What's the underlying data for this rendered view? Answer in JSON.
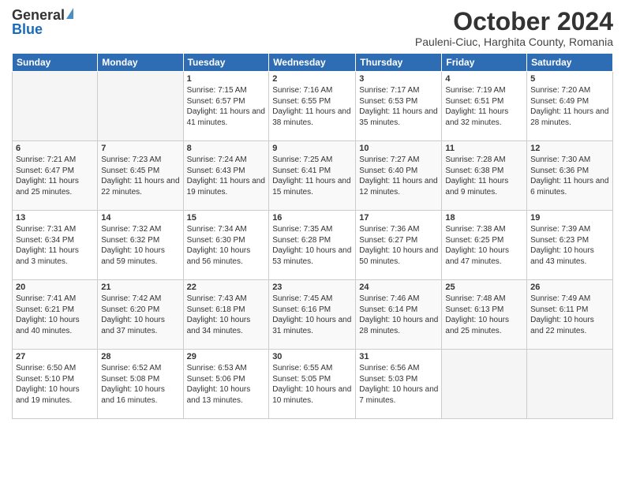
{
  "logo": {
    "general": "General",
    "blue": "Blue"
  },
  "title": "October 2024",
  "subtitle": "Pauleni-Ciuc, Harghita County, Romania",
  "headers": [
    "Sunday",
    "Monday",
    "Tuesday",
    "Wednesday",
    "Thursday",
    "Friday",
    "Saturday"
  ],
  "weeks": [
    [
      {
        "day": "",
        "info": ""
      },
      {
        "day": "",
        "info": ""
      },
      {
        "day": "1",
        "info": "Sunrise: 7:15 AM\nSunset: 6:57 PM\nDaylight: 11 hours and 41 minutes."
      },
      {
        "day": "2",
        "info": "Sunrise: 7:16 AM\nSunset: 6:55 PM\nDaylight: 11 hours and 38 minutes."
      },
      {
        "day": "3",
        "info": "Sunrise: 7:17 AM\nSunset: 6:53 PM\nDaylight: 11 hours and 35 minutes."
      },
      {
        "day": "4",
        "info": "Sunrise: 7:19 AM\nSunset: 6:51 PM\nDaylight: 11 hours and 32 minutes."
      },
      {
        "day": "5",
        "info": "Sunrise: 7:20 AM\nSunset: 6:49 PM\nDaylight: 11 hours and 28 minutes."
      }
    ],
    [
      {
        "day": "6",
        "info": "Sunrise: 7:21 AM\nSunset: 6:47 PM\nDaylight: 11 hours and 25 minutes."
      },
      {
        "day": "7",
        "info": "Sunrise: 7:23 AM\nSunset: 6:45 PM\nDaylight: 11 hours and 22 minutes."
      },
      {
        "day": "8",
        "info": "Sunrise: 7:24 AM\nSunset: 6:43 PM\nDaylight: 11 hours and 19 minutes."
      },
      {
        "day": "9",
        "info": "Sunrise: 7:25 AM\nSunset: 6:41 PM\nDaylight: 11 hours and 15 minutes."
      },
      {
        "day": "10",
        "info": "Sunrise: 7:27 AM\nSunset: 6:40 PM\nDaylight: 11 hours and 12 minutes."
      },
      {
        "day": "11",
        "info": "Sunrise: 7:28 AM\nSunset: 6:38 PM\nDaylight: 11 hours and 9 minutes."
      },
      {
        "day": "12",
        "info": "Sunrise: 7:30 AM\nSunset: 6:36 PM\nDaylight: 11 hours and 6 minutes."
      }
    ],
    [
      {
        "day": "13",
        "info": "Sunrise: 7:31 AM\nSunset: 6:34 PM\nDaylight: 11 hours and 3 minutes."
      },
      {
        "day": "14",
        "info": "Sunrise: 7:32 AM\nSunset: 6:32 PM\nDaylight: 10 hours and 59 minutes."
      },
      {
        "day": "15",
        "info": "Sunrise: 7:34 AM\nSunset: 6:30 PM\nDaylight: 10 hours and 56 minutes."
      },
      {
        "day": "16",
        "info": "Sunrise: 7:35 AM\nSunset: 6:28 PM\nDaylight: 10 hours and 53 minutes."
      },
      {
        "day": "17",
        "info": "Sunrise: 7:36 AM\nSunset: 6:27 PM\nDaylight: 10 hours and 50 minutes."
      },
      {
        "day": "18",
        "info": "Sunrise: 7:38 AM\nSunset: 6:25 PM\nDaylight: 10 hours and 47 minutes."
      },
      {
        "day": "19",
        "info": "Sunrise: 7:39 AM\nSunset: 6:23 PM\nDaylight: 10 hours and 43 minutes."
      }
    ],
    [
      {
        "day": "20",
        "info": "Sunrise: 7:41 AM\nSunset: 6:21 PM\nDaylight: 10 hours and 40 minutes."
      },
      {
        "day": "21",
        "info": "Sunrise: 7:42 AM\nSunset: 6:20 PM\nDaylight: 10 hours and 37 minutes."
      },
      {
        "day": "22",
        "info": "Sunrise: 7:43 AM\nSunset: 6:18 PM\nDaylight: 10 hours and 34 minutes."
      },
      {
        "day": "23",
        "info": "Sunrise: 7:45 AM\nSunset: 6:16 PM\nDaylight: 10 hours and 31 minutes."
      },
      {
        "day": "24",
        "info": "Sunrise: 7:46 AM\nSunset: 6:14 PM\nDaylight: 10 hours and 28 minutes."
      },
      {
        "day": "25",
        "info": "Sunrise: 7:48 AM\nSunset: 6:13 PM\nDaylight: 10 hours and 25 minutes."
      },
      {
        "day": "26",
        "info": "Sunrise: 7:49 AM\nSunset: 6:11 PM\nDaylight: 10 hours and 22 minutes."
      }
    ],
    [
      {
        "day": "27",
        "info": "Sunrise: 6:50 AM\nSunset: 5:10 PM\nDaylight: 10 hours and 19 minutes."
      },
      {
        "day": "28",
        "info": "Sunrise: 6:52 AM\nSunset: 5:08 PM\nDaylight: 10 hours and 16 minutes."
      },
      {
        "day": "29",
        "info": "Sunrise: 6:53 AM\nSunset: 5:06 PM\nDaylight: 10 hours and 13 minutes."
      },
      {
        "day": "30",
        "info": "Sunrise: 6:55 AM\nSunset: 5:05 PM\nDaylight: 10 hours and 10 minutes."
      },
      {
        "day": "31",
        "info": "Sunrise: 6:56 AM\nSunset: 5:03 PM\nDaylight: 10 hours and 7 minutes."
      },
      {
        "day": "",
        "info": ""
      },
      {
        "day": "",
        "info": ""
      }
    ]
  ]
}
